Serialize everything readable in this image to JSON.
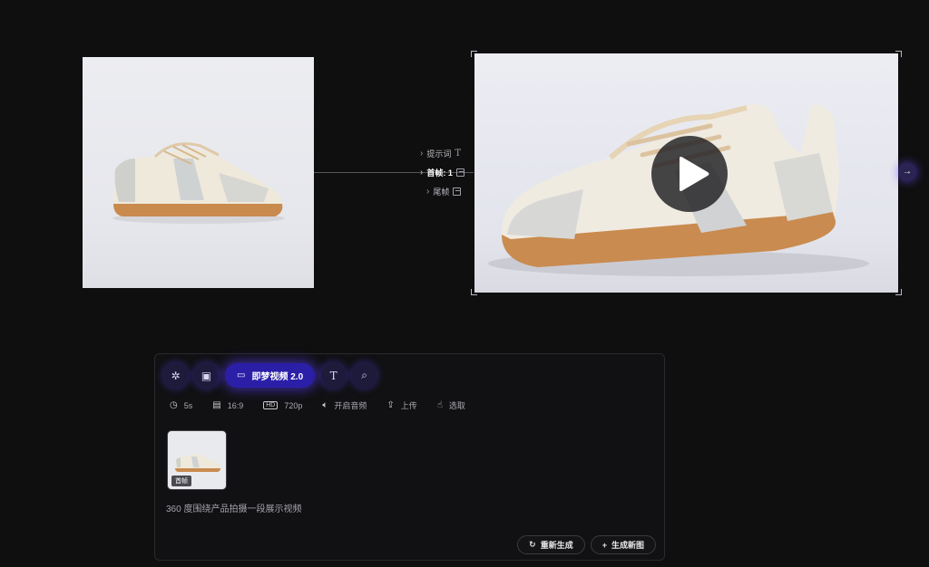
{
  "canvas": {
    "ports": [
      {
        "label": "提示词",
        "icon": "text-icon"
      },
      {
        "label": "首帧: 1",
        "icon": "image-icon"
      },
      {
        "label": "尾帧",
        "icon": "image-icon"
      }
    ]
  },
  "toolbar": {
    "model_label": "即梦视频 2.0"
  },
  "settings": {
    "duration": "5s",
    "ratio": "16:9",
    "resolution": "720p",
    "audio": "开启音频",
    "upload": "上传",
    "select": "选取"
  },
  "reference": {
    "tag": "首帧"
  },
  "prompt": {
    "text": "360 度围绕产品拍摄一段展示视频"
  },
  "actions": {
    "regenerate": "重新生成",
    "new_image": "生成新图"
  },
  "colors": {
    "accent": "#2b1fa8",
    "background": "#0f0f10"
  }
}
